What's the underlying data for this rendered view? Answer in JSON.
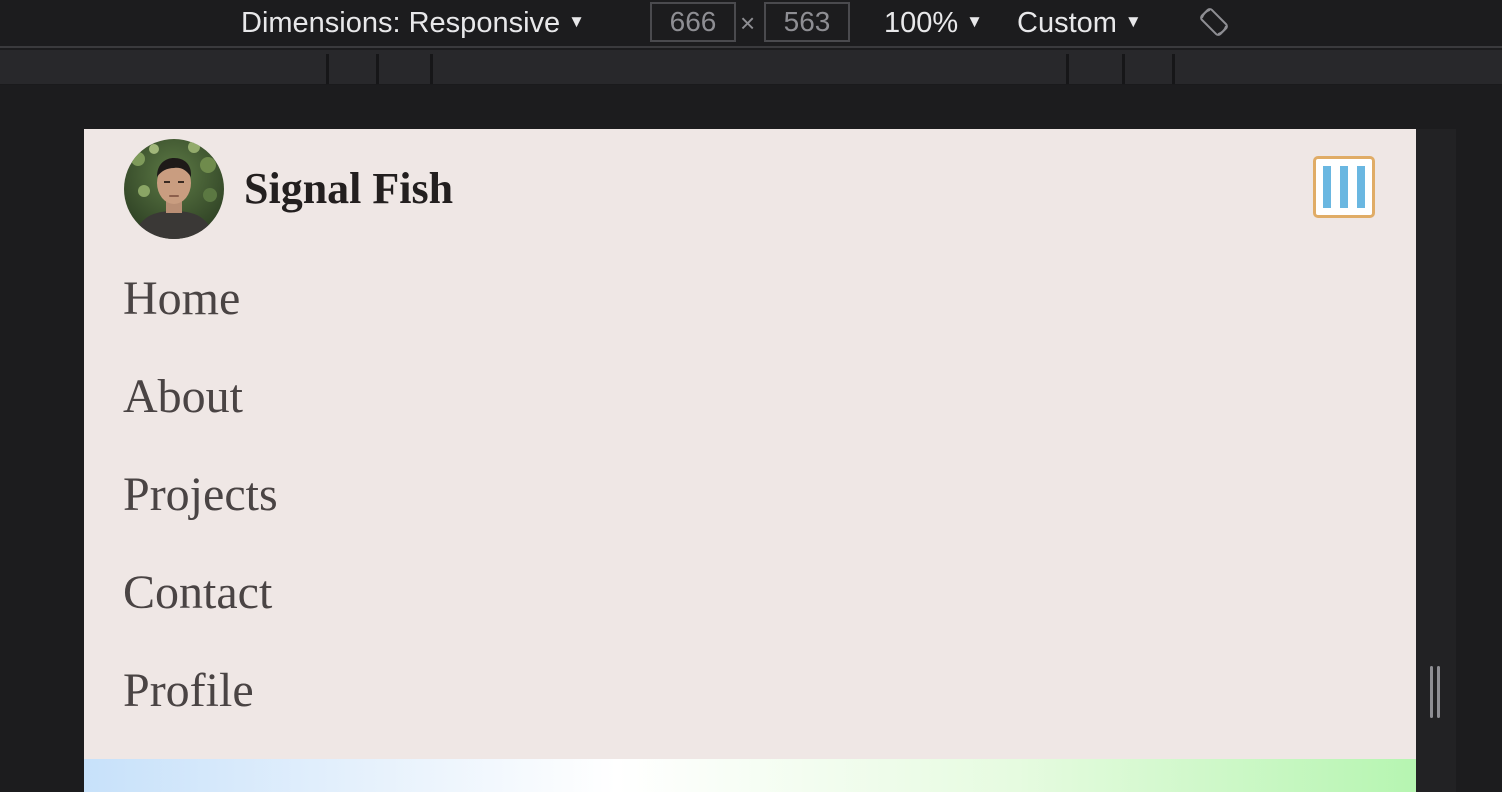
{
  "devtools": {
    "dimensions_label": "Dimensions: Responsive",
    "width_value": "666",
    "height_value": "563",
    "times_symbol": "×",
    "zoom_label": "100%",
    "throttle_label": "Custom",
    "caret": "▼",
    "rotate_icon": "rotate-device-icon"
  },
  "site": {
    "title": "Signal Fish",
    "avatar_icon": "profile-photo",
    "menu_icon": "menu-toggle-icon",
    "nav": [
      {
        "label": "Home"
      },
      {
        "label": "About"
      },
      {
        "label": "Projects"
      },
      {
        "label": "Contact"
      },
      {
        "label": "Profile"
      }
    ]
  },
  "colors": {
    "devtools_bg": "#1c1c1e",
    "page_bg": "#efe7e5",
    "title_color": "#231f1f",
    "nav_color": "#4a4444",
    "menu_border": "#e0ac66",
    "menu_bars": "#6ab7e1",
    "gradient_start": "#c7e1fa",
    "gradient_end": "#b6f5b1"
  }
}
